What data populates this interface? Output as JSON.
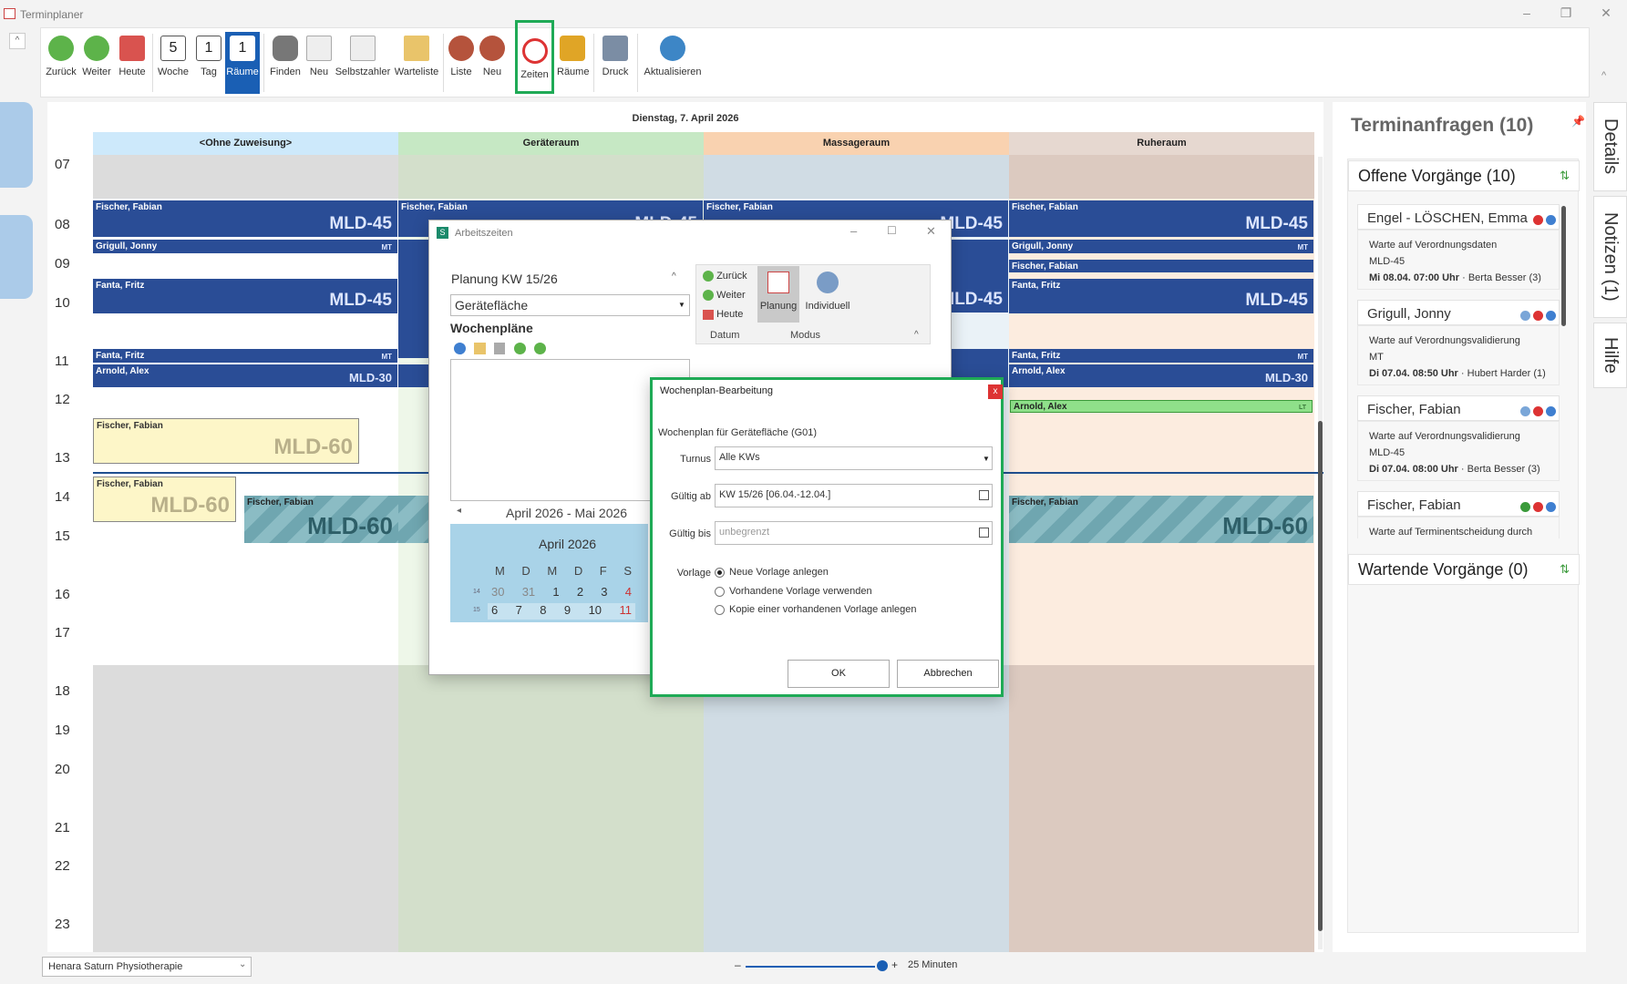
{
  "window": {
    "title": "Terminplaner"
  },
  "ribbon": {
    "buttons": [
      "Zurück",
      "Weiter",
      "Heute",
      "Woche",
      "Tag",
      "Räume",
      "Finden",
      "Neu",
      "Selbstzahler",
      "Warteliste",
      "Liste",
      "Neu",
      "Zeiten",
      "Räume",
      "Druck",
      "Aktualisieren"
    ],
    "week_num": "5",
    "day_num": "1",
    "room_num": "1"
  },
  "calendar": {
    "date": "Dienstag, 7. April 2026",
    "columns": [
      "<Ohne Zuweisung>",
      "Geräteraum",
      "Massageraum",
      "Ruheraum"
    ],
    "hours": [
      "07",
      "08",
      "09",
      "10",
      "11",
      "12",
      "13",
      "14",
      "15",
      "16",
      "17",
      "18",
      "19",
      "20",
      "21",
      "22",
      "23"
    ],
    "appointments": {
      "fischer_fabian": "Fischer, Fabian",
      "grigull_jonny": "Grigull, Jonny",
      "fanta_fritz": "Fanta, Fritz",
      "arnold_alex": "Arnold, Alex",
      "mld45": "MLD-45",
      "mld30": "MLD-30",
      "mld60": "MLD-60",
      "mt": "MT",
      "lt": "LT"
    }
  },
  "arbeitszeiten": {
    "title": "Arbeitszeiten",
    "planung": "Planung KW 15/26",
    "select": "Gerätefläche",
    "wochenplaene": "Wochenpläne",
    "nav": [
      "Zurück",
      "Weiter",
      "Heute"
    ],
    "modes": [
      "Planung",
      "Individuell"
    ],
    "groups": [
      "Datum",
      "Modus"
    ],
    "month_range": "April 2026 - Mai 2026",
    "month": "April 2026",
    "weekdays": [
      "M",
      "D",
      "M",
      "D",
      "F",
      "S"
    ],
    "week14": {
      "kw": "14",
      "days": [
        "30",
        "31",
        "1",
        "2",
        "3",
        "4"
      ]
    },
    "week15": {
      "kw": "15",
      "days": [
        "6",
        "7",
        "8",
        "9",
        "10",
        "11"
      ]
    }
  },
  "wochenplan": {
    "title": "Wochenplan-Bearbeitung",
    "close": "x",
    "heading": "Wochenplan für Gerätefläche (G01)",
    "turnus_label": "Turnus",
    "turnus_value": "Alle KWs",
    "gueltig_ab_label": "Gültig ab",
    "gueltig_ab_value": "KW 15/26 [06.04.-12.04.]",
    "gueltig_bis_label": "Gültig bis",
    "gueltig_bis_value": "unbegrenzt",
    "vorlage_label": "Vorlage",
    "options": [
      "Neue Vorlage anlegen",
      "Vorhandene Vorlage verwenden",
      "Kopie einer vorhandenen Vorlage anlegen"
    ],
    "ok": "OK",
    "cancel": "Abbrechen"
  },
  "requests": {
    "title": "Terminanfragen (10)",
    "offene": "Offene Vorgänge (10)",
    "wartende": "Wartende Vorgänge (0)",
    "items": [
      {
        "name": "Engel - LÖSCHEN, Emma",
        "status": "Warte auf Verordnungsdaten",
        "code": "MLD-45",
        "date": "Mi 08.04. 07:00 Uhr",
        "who": "· Berta Besser (3)"
      },
      {
        "name": "Grigull, Jonny",
        "status": "Warte auf Verordnungsvalidierung",
        "code": "MT",
        "date": "Di 07.04. 08:50 Uhr",
        "who": "· Hubert Harder (1)"
      },
      {
        "name": "Fischer, Fabian",
        "status": "Warte auf Verordnungsvalidierung",
        "code": "MLD-45",
        "date": "Di 07.04. 08:00 Uhr",
        "who": "· Berta Besser (3)"
      },
      {
        "name": "Fischer, Fabian",
        "status": "Warte auf Termin­entscheidung durch Pra..."
      }
    ]
  },
  "sidetabs": [
    "Details",
    "Notizen (1)",
    "Hilfe"
  ],
  "status": {
    "practice": "Henara Saturn Physiotherapie",
    "zoom": "25 Minuten"
  },
  "colors": {
    "accent": "#1a5fb4",
    "highlight": "#1faa56",
    "appt": "#2a4d96"
  }
}
